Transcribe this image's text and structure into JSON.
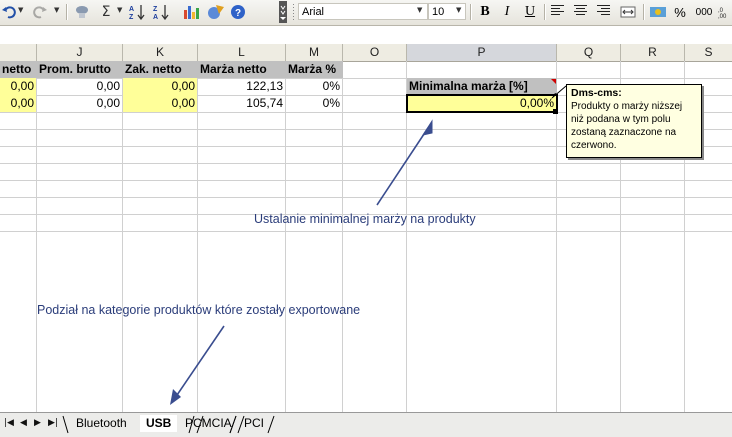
{
  "toolbar": {
    "font_name": "Arial",
    "font_size": "10",
    "bold": "B",
    "italic": "I",
    "underline": "U",
    "percent": "%",
    "thousands": "000",
    "sigma": "Σ"
  },
  "columns": [
    "J",
    "K",
    "L",
    "M",
    "O",
    "P",
    "Q",
    "R",
    "S"
  ],
  "headers": {
    "i_partial": "netto",
    "j": "Prom. brutto",
    "k": "Zak. netto",
    "l": "Marża netto",
    "m": "Marża %"
  },
  "rows": [
    {
      "i": "0,00",
      "j": "0,00",
      "k": "0,00",
      "l": "122,13",
      "m": "0%"
    },
    {
      "i": "0,00",
      "j": "0,00",
      "k": "0,00",
      "l": "105,74",
      "m": "0%"
    }
  ],
  "min_margin": {
    "label": "Minimalna marża [%]",
    "value": "0,00%"
  },
  "comment": {
    "author": "Dms-cms:",
    "text": "Produkty o marży niższej niż podana w tym polu zostaną zaznaczone na czerwono."
  },
  "annotations": {
    "margin_note": "Ustalanie minimalnej marży na produkty",
    "category_note": "Podział na kategorie produktów które zostały exportowane"
  },
  "sheet_tabs": [
    {
      "label": "Bluetooth",
      "active": false
    },
    {
      "label": "USB",
      "active": true
    },
    {
      "label": "PCMCIA",
      "active": false
    },
    {
      "label": "PCI",
      "active": false
    }
  ],
  "colors": {
    "yellow_cell": "#ffff99",
    "annotation_text": "#2b3d7a",
    "arrow": "#3a4d8f",
    "comment_bg": "#ffffe1"
  }
}
